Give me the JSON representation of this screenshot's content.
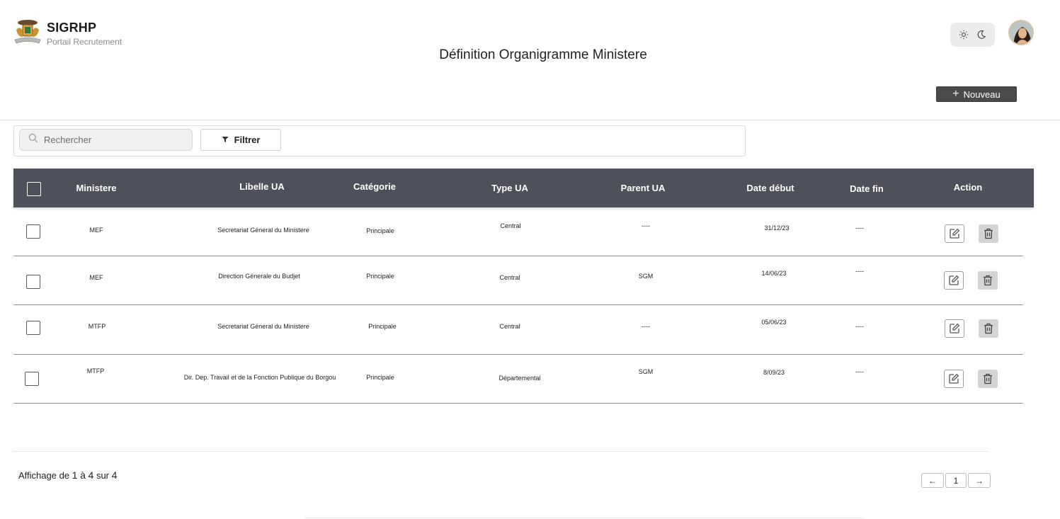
{
  "header": {
    "brand_name": "SIGRHP",
    "brand_subtitle": "Portail Recrutement",
    "page_title": "Définition Organigramme Ministere",
    "theme_icons": [
      "sun-icon",
      "moon-icon"
    ],
    "new_button_label": "Nouveau"
  },
  "toolbar": {
    "search_placeholder": "Rechercher",
    "filter_label": "Filtrer"
  },
  "table": {
    "columns": [
      "Ministere",
      "Libelle UA",
      "Catégorie",
      "Type UA",
      "Parent UA",
      "Date début",
      "Date fin",
      "Action"
    ],
    "rows": [
      {
        "ministere": "MEF",
        "libelle": "Secretariat Géneral du Ministere",
        "categorie": "Principale",
        "type": "Central",
        "parent": "----",
        "date_debut": "31/12/23",
        "date_fin": "----"
      },
      {
        "ministere": "MEF",
        "libelle": "Direction Génerale du Budjet",
        "categorie": "Principale",
        "type": "Central",
        "parent": "SGM",
        "date_debut": "14/06/23",
        "date_fin": "----"
      },
      {
        "ministere": "MTFP",
        "libelle": "Secretariat Géneral du Ministere",
        "categorie": "Principale",
        "type": "Central",
        "parent": "----",
        "date_debut": "05/06/23",
        "date_fin": "----"
      },
      {
        "ministere": "MTFP",
        "libelle": "Dir. Dep. Travail et de la Fonction Publique du Borgou",
        "categorie": "Principale",
        "type": "Départemental",
        "parent": "SGM",
        "date_debut": "8/09/23",
        "date_fin": "----"
      }
    ]
  },
  "footer": {
    "summary_prefix": "Affichage de",
    "summary_from": "1",
    "summary_mid": "à",
    "summary_to": "4",
    "summary_sep": "sur",
    "summary_total": "4",
    "current_page": "1",
    "prev_arrow": "←",
    "next_arrow": "→"
  },
  "colors": {
    "table_header": "#4e5159",
    "new_button": "#4a4a4a",
    "delete_button": "#d4d4d4"
  }
}
